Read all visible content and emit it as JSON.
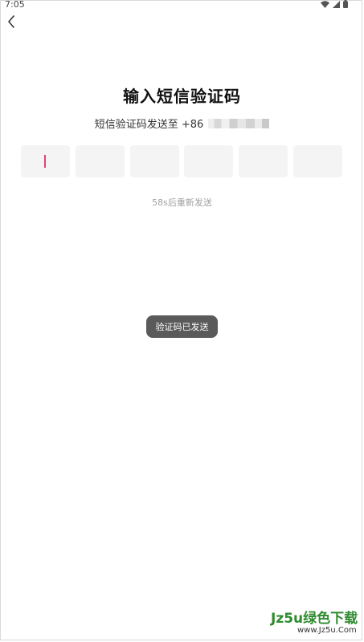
{
  "status_bar": {
    "time": "7:05",
    "icons": [
      "wifi-icon",
      "signal-icon",
      "battery-icon"
    ]
  },
  "header": {
    "back_icon": "chevron-left-icon"
  },
  "main": {
    "title": "输入短信验证码",
    "subtitle_prefix": "短信验证码发送至 +86",
    "code_boxes": [
      "",
      "",
      "",
      "",
      "",
      ""
    ],
    "active_box_index": 0,
    "caret_color": "#e0407a",
    "resend_text": "58s后重新发送"
  },
  "toast": {
    "text": "验证码已发送"
  },
  "watermark": {
    "brand": "Jz5u绿色下载",
    "url": "www.Jz5u.Com"
  }
}
